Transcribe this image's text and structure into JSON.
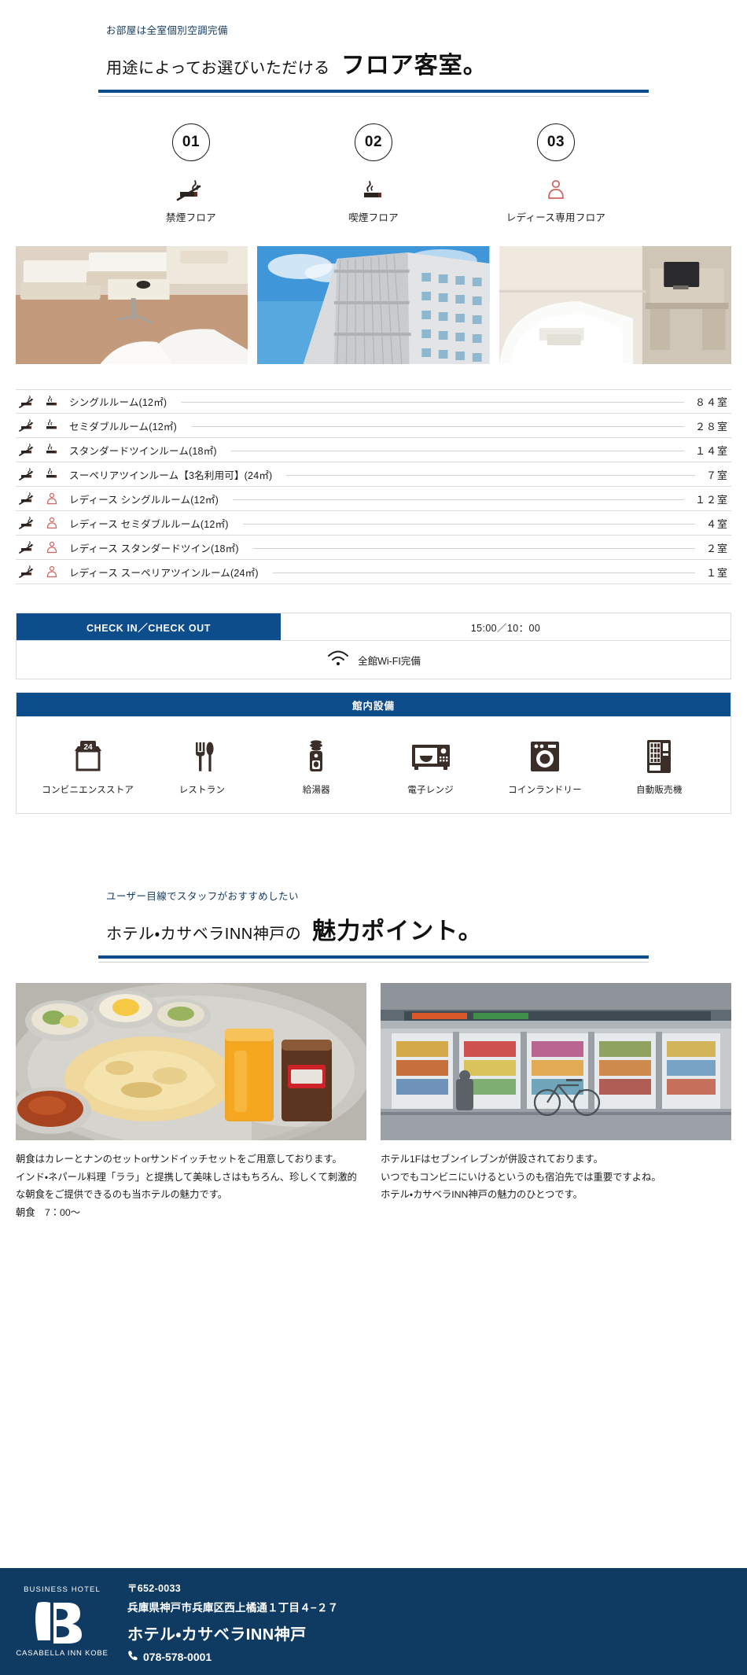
{
  "section1": {
    "eyebrow": "お部屋は全室個別空調完備",
    "title_small": "用途によってお選びいただける",
    "title_big": "フロア客室。",
    "accent_color": "#0d4d8c"
  },
  "floors": [
    {
      "number": "01",
      "icon": "no-smoking-icon",
      "label": "禁煙フロア"
    },
    {
      "number": "02",
      "icon": "smoking-icon",
      "label": "喫煙フロア"
    },
    {
      "number": "03",
      "icon": "ladies-icon",
      "label": "レディース専用フロア"
    }
  ],
  "photos": [
    {
      "name": "photo-guest-room-twin",
      "alt": "客室ツイン"
    },
    {
      "name": "photo-hotel-exterior",
      "alt": "ホテル外観"
    },
    {
      "name": "photo-guest-room-single",
      "alt": "客室シングル"
    }
  ],
  "rooms": [
    {
      "icons": [
        "no-smoking-icon",
        "smoking-icon"
      ],
      "name": "シングルルーム(12㎡)",
      "count": "８４室"
    },
    {
      "icons": [
        "no-smoking-icon",
        "smoking-icon"
      ],
      "name": "セミダブルルーム(12㎡)",
      "count": "２８室"
    },
    {
      "icons": [
        "no-smoking-icon",
        "smoking-icon"
      ],
      "name": "スタンダードツインルーム(18㎡)",
      "count": "１４室"
    },
    {
      "icons": [
        "no-smoking-icon",
        "smoking-icon"
      ],
      "name": "スーペリアツインルーム【3名利用可】(24㎡)",
      "count": "７室"
    },
    {
      "icons": [
        "no-smoking-icon",
        "ladies-icon"
      ],
      "name": "レディース シングルルーム(12㎡)",
      "count": "１２室"
    },
    {
      "icons": [
        "no-smoking-icon",
        "ladies-icon"
      ],
      "name": "レディース セミダブルルーム(12㎡)",
      "count": "４室"
    },
    {
      "icons": [
        "no-smoking-icon",
        "ladies-icon"
      ],
      "name": "レディース スタンダードツイン(18㎡)",
      "count": "２室"
    },
    {
      "icons": [
        "no-smoking-icon",
        "ladies-icon"
      ],
      "name": "レディース スーペリアツインルーム(24㎡)",
      "count": "１室"
    }
  ],
  "checkin": {
    "label": "CHECK IN／CHECK OUT",
    "value": "15:00／10：00"
  },
  "wifi": {
    "icon": "wifi-icon",
    "label": "全館Wi-FI完備"
  },
  "facilities": {
    "heading": "館内設備",
    "items": [
      {
        "icon": "convenience-store-icon",
        "label": "コンビニエンスストア"
      },
      {
        "icon": "restaurant-icon",
        "label": "レストラン"
      },
      {
        "icon": "water-dispenser-icon",
        "label": "給湯器"
      },
      {
        "icon": "microwave-icon",
        "label": "電子レンジ"
      },
      {
        "icon": "laundry-icon",
        "label": "コインランドリー"
      },
      {
        "icon": "vending-machine-icon",
        "label": "自動販売機"
      }
    ]
  },
  "section2": {
    "eyebrow": "ユーザー目線でスタッフがおすすめしたい",
    "title_small": "ホテル・カサベラINN神戸の",
    "title_big": "魅力ポイント。"
  },
  "cards": [
    {
      "image": "photo-breakfast-curry-naan",
      "text": "朝食はカレーとナンのセットorサンドイッチセットをご用意しております。\nインド・ネパール料理「ララ」と提携して美味しさはもちろん、珍しくて刺激的な朝食をご提供できるのも当ホテルの魅力です。\n朝食　7：00〜"
    },
    {
      "image": "photo-convenience-store",
      "text": "ホテル1Fはセブンイレブンが併設されております。\nいつでもコンビニにいけるというのも宿泊先では重要ですよね。\nホテル・カサベラINN神戸の魅力のひとつです。"
    }
  ],
  "footer": {
    "logo_top": "BUSINESS HOTEL",
    "logo_bottom": "CASABELLA INN KOBE",
    "zip": "〒652-0033",
    "address": "兵庫県神戸市兵庫区西上橘通１丁目４−２７",
    "hotel_name": "ホテル・カサベラINN神戸",
    "phone": "078-578-0001",
    "phone_icon": "phone-icon",
    "bg_color": "#0f3b63"
  }
}
